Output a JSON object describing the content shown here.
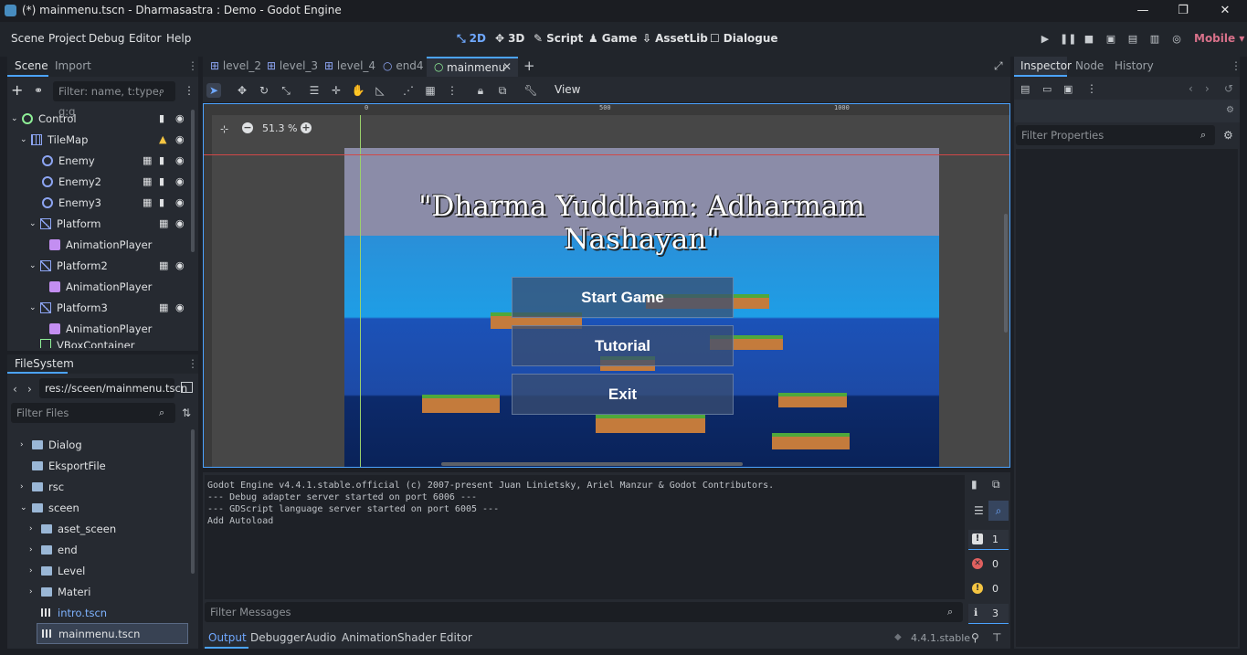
{
  "window": {
    "title": "(*) mainmenu.tscn - Dharmasastra : Demo - Godot Engine"
  },
  "menu": {
    "items": [
      "Scene",
      "Project",
      "Debug",
      "Editor",
      "Help"
    ]
  },
  "workspaces": {
    "w2d": "2D",
    "w3d": "3D",
    "script": "Script",
    "game": "Game",
    "assetlib": "AssetLib",
    "dialogue": "Dialogue"
  },
  "renderer": "Mobile",
  "scene_dock": {
    "tab_scene": "Scene",
    "tab_import": "Import",
    "filter_placeholder": "Filter: name, t:type, g:g",
    "nodes": [
      "Control",
      "TileMap",
      "Enemy",
      "Enemy2",
      "Enemy3",
      "Platform",
      "AnimationPlayer",
      "Platform2",
      "AnimationPlayer",
      "Platform3",
      "AnimationPlayer",
      "VBoxContainer"
    ]
  },
  "filesystem": {
    "tab": "FileSystem",
    "path": "res://sceen/mainmenu.tscn",
    "filter_placeholder": "Filter Files",
    "items": [
      "Dialog",
      "EksportFile",
      "rsc",
      "sceen",
      "aset_sceen",
      "end",
      "Level",
      "Materi",
      "intro.tscn",
      "mainmenu.tscn"
    ]
  },
  "editor_tabs": [
    "level_2",
    "level_3",
    "level_4",
    "end4",
    "mainmenu"
  ],
  "toolbar": {
    "view": "View"
  },
  "viewport": {
    "zoom": "51.3 %",
    "ruler": [
      "0",
      "500",
      "1000"
    ],
    "game_title": "\"Dharma Yuddham: Adharmam Nashayan\"",
    "buttons": [
      "Start Game",
      "Tutorial",
      "Exit"
    ]
  },
  "output": {
    "lines": [
      "Godot Engine v4.4.1.stable.official (c) 2007-present Juan Linietsky, Ariel Manzur & Godot Contributors.",
      "--- Debug adapter server started on port 6006 ---",
      "--- GDScript language server started on port 6005 ---",
      "Add Autoload"
    ],
    "filter_placeholder": "Filter Messages",
    "counts": {
      "messages": "1",
      "errors": "0",
      "warnings": "0",
      "info": "3"
    }
  },
  "bottom_tabs": [
    "Output",
    "Debugger",
    "Audio",
    "Animation",
    "Shader Editor"
  ],
  "version": "4.4.1.stable",
  "inspector": {
    "tab_inspector": "Inspector",
    "tab_node": "Node",
    "tab_history": "History",
    "filter_placeholder": "Filter Properties"
  },
  "colors": {
    "accent": "#6fa8ff",
    "bg": "#262a31",
    "tab_active": "#4ba3ff"
  }
}
